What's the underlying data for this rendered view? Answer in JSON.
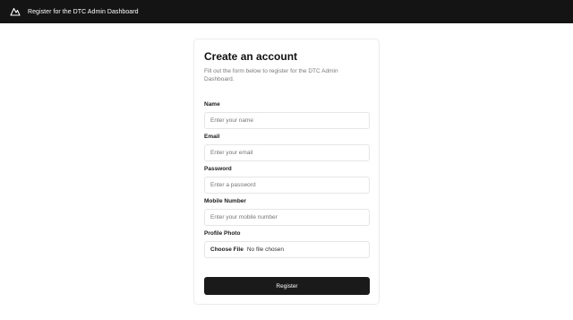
{
  "header": {
    "title": "Register for the DTC Admin Dashboard",
    "logo_icon": "mountain-logo-icon"
  },
  "form": {
    "title": "Create an account",
    "description": "Fill out the form below to register for the DTC Admin Dashboard.",
    "fields": [
      {
        "label": "Name",
        "placeholder": "Enter your name"
      },
      {
        "label": "Email",
        "placeholder": "Enter your email"
      },
      {
        "label": "Password",
        "placeholder": "Enter a password"
      },
      {
        "label": "Mobile Number",
        "placeholder": "Enter your mobile number"
      }
    ],
    "photo": {
      "label": "Profile Photo",
      "button_label": "Choose File",
      "status": "No file chosen"
    },
    "submit_label": "Register"
  },
  "colors": {
    "topbar_bg": "#141414",
    "button_bg": "#1a1a1a",
    "border": "#e6e6e6"
  }
}
